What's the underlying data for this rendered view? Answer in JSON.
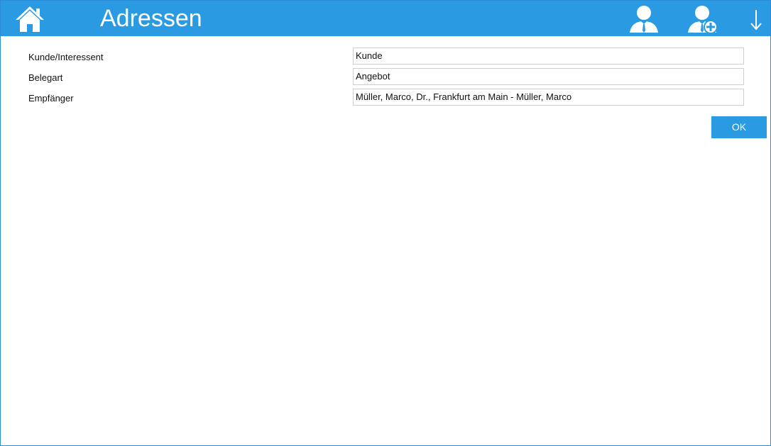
{
  "header": {
    "title": "Adressen",
    "icons": {
      "home": "home-icon",
      "person": "person-icon",
      "person_add": "person-add-icon",
      "download": "arrow-down-icon"
    },
    "color": "#2a9ae2"
  },
  "form": {
    "rows": [
      {
        "label": "Kunde/Interessent",
        "value": "Kunde"
      },
      {
        "label": "Belegart",
        "value": "Angebot"
      },
      {
        "label": "Empfänger",
        "value": "Müller, Marco, Dr., Frankfurt am Main - Müller, Marco"
      }
    ],
    "ok_label": "OK"
  }
}
